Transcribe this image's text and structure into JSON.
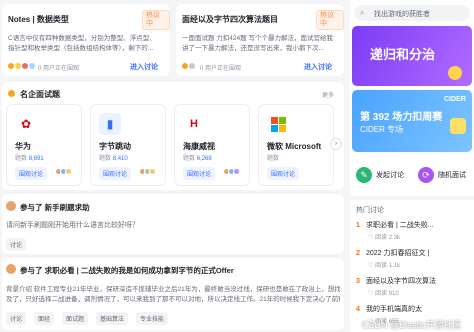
{
  "posts": [
    {
      "title": "Notes | 数据类型",
      "badge": "热议中",
      "desc": "C语言中仅有四种数据类型，分别为整型、浮点型、",
      "desc2": "指针型和枚举类型（包括数组结构体等），剩下的...",
      "online": "0 用户正在围观",
      "enter": "进入讨论"
    },
    {
      "title": "面经以及字节四次算法题目",
      "badge": "热议中",
      "desc": "一面面试题 力扣424题 写个个暴力解法，面试官给我",
      "desc2": "讲了一下暴力解法，还是没写出来，我小鹅下次...",
      "online": "0 用户正在围观",
      "enter": "进入讨论"
    }
  ],
  "companies_section": {
    "title": "名企面试题",
    "more": "更多"
  },
  "companies": [
    {
      "name": "华为",
      "count_label": "题数",
      "count": "8,691",
      "btn": "围观讨论",
      "logo": "✿",
      "logo_color": "#e60012",
      "logo_bg": "#fff"
    },
    {
      "name": "字节跳动",
      "count_label": "题数",
      "count": "8,410",
      "btn": "围观讨论",
      "logo": "▮",
      "logo_color": "#3370ff",
      "logo_bg": "#eaf3ff"
    },
    {
      "name": "海康威视",
      "count_label": "题数",
      "count": "6,268",
      "btn": "围观讨论",
      "logo": "H",
      "logo_color": "#d7000f",
      "logo_bg": "#fff"
    },
    {
      "name": "微软 Microsoft",
      "count_label": "题数",
      "count": "",
      "btn": "围观讨论",
      "logo": "⊞",
      "logo_color": "#f25022",
      "logo_bg": "#fff"
    }
  ],
  "feed1": {
    "author_line": "参与了 新手刷题求助",
    "question": "请问新手刷题刚开始用什么语言比较好呀？",
    "tag": "讨论"
  },
  "feed2": {
    "author_line": "参与了 求职必看 | 二战失败的我是如何成功拿到字节的正式Offer",
    "text1": "背景介绍 软件工程专业21年毕业，保研深造不揽辅毕业之后21年为，最终敢当没过线，保研也是敢在了政治上，想找工作也是来不",
    "text2": "及了，只好选择二战进备，调剂情况了，可以来我到了那不可以对地，所以决定线工作。21年的时候我下定决心了前程和目的Offer。",
    "tags": [
      "讨论",
      "面经",
      "面试题",
      "基础算法",
      "专业技能"
    ]
  },
  "sidebar": {
    "search_placeholder": "找出游戏的获胜者",
    "banner1_title": "递归和分治",
    "banner2_title": "第 392 场力扣周赛",
    "banner2_sub": "CIDER 专场",
    "banner2_logo": "CIDER",
    "action1": "发起讨论",
    "action2": "随机面试",
    "hot_title": "热门讨论",
    "hot_items": [
      {
        "num": "1",
        "text": "求职必看 | 二战失败..."
      },
      {
        "num": "2",
        "text": "2022 力扣春招征文 |"
      },
      {
        "num": "3",
        "text": "面经以及字节四次算法"
      },
      {
        "num": "4",
        "text": "我的手机端真的太"
      }
    ],
    "hot_sub": [
      "♡ 阅读 2.3k",
      "♡ 阅读 1.1k",
      "♡ 阅读 910",
      "♡ 阅读 655"
    ]
  },
  "watermark": "CSDN @Elastic开源社区",
  "colors": {
    "accent": "#3370ff",
    "orange": "#ff8a3d",
    "green": "#2bb673",
    "purple": "#a855f7"
  }
}
